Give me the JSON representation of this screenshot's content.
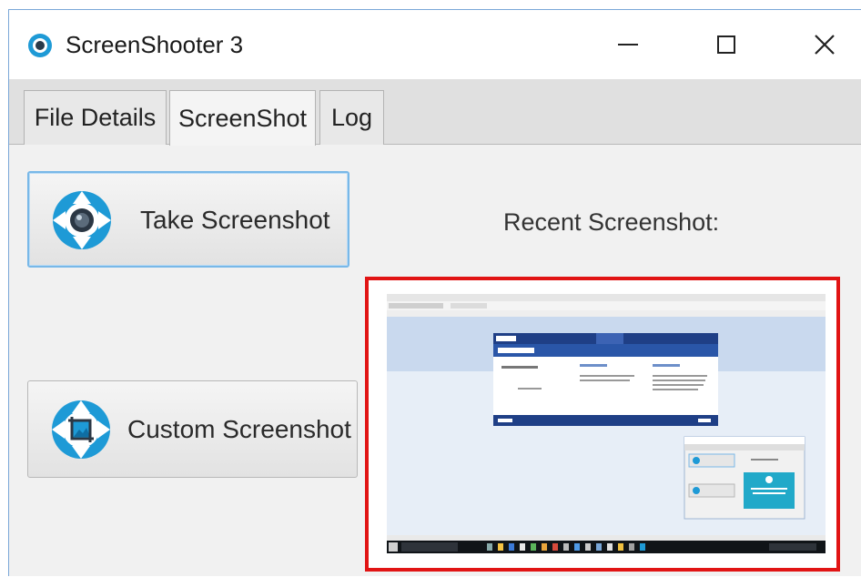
{
  "window": {
    "title": "ScreenShooter 3",
    "controls": {
      "minimize": "—",
      "maximize": "□",
      "close": "✕"
    }
  },
  "tabs": [
    {
      "label": "File Details",
      "active": false
    },
    {
      "label": "ScreenShot",
      "active": true
    },
    {
      "label": "Log",
      "active": false
    }
  ],
  "actions": {
    "take_screenshot": "Take Screenshot",
    "custom_screenshot": "Custom Screenshot"
  },
  "preview": {
    "label": "Recent Screenshot:",
    "border_color": "#e11414"
  },
  "colors": {
    "accent": "#1e9ad6",
    "focus_border": "#78b8e8"
  },
  "icons": {
    "app": "camera-aperture-icon",
    "take": "camera-aperture-icon",
    "custom": "crop-aperture-icon"
  }
}
